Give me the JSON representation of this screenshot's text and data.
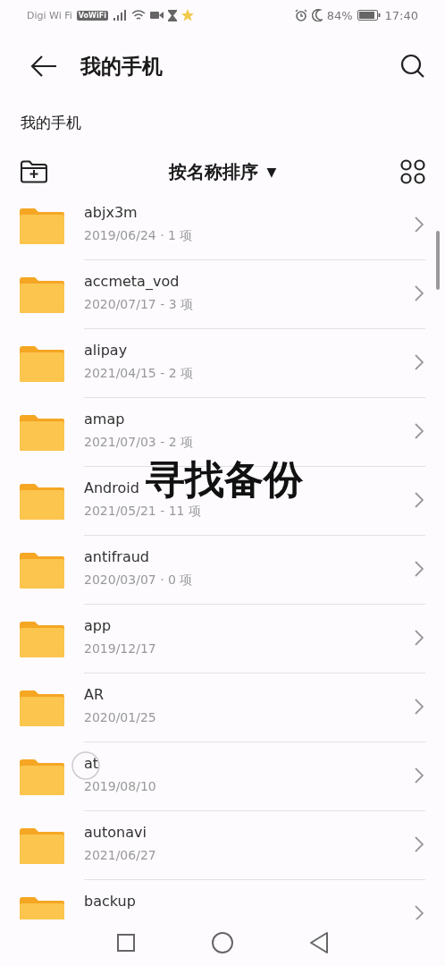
{
  "status_bar": {
    "carrier": "Digi Wi Fi",
    "vowifi": "VoWiFi",
    "battery": "84%",
    "time": "17:40"
  },
  "header": {
    "title": "我的手机"
  },
  "breadcrumb": "我的手机",
  "toolbar": {
    "sort_label": "按名称排序",
    "sort_caret": "▼"
  },
  "files": [
    {
      "name": "abjx3m",
      "meta": "2019/06/24 · 1 项"
    },
    {
      "name": "accmeta_vod",
      "meta": "2020/07/17 - 3 项"
    },
    {
      "name": "alipay",
      "meta": "2021/04/15 - 2 项"
    },
    {
      "name": "amap",
      "meta": "2021/07/03 - 2 项"
    },
    {
      "name": "Android",
      "meta": "2021/05/21 - 11 项"
    },
    {
      "name": "antifraud",
      "meta": "2020/03/07 · 0 项"
    },
    {
      "name": "app",
      "meta": "2019/12/17"
    },
    {
      "name": "AR",
      "meta": "2020/01/25"
    },
    {
      "name": "at",
      "meta": "2019/08/10"
    },
    {
      "name": "autonavi",
      "meta": "2021/06/27"
    },
    {
      "name": "backup"
    }
  ],
  "caption": "寻找备份"
}
